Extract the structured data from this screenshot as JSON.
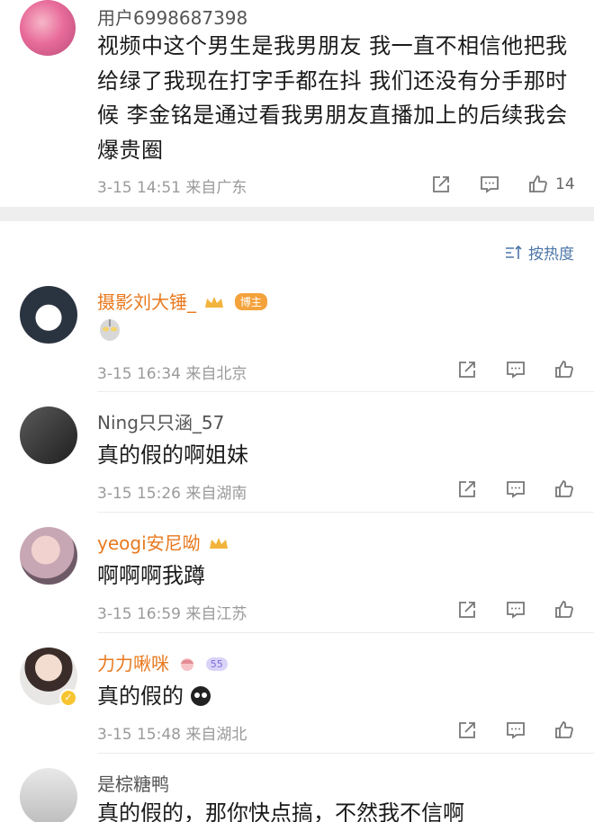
{
  "top_post": {
    "username": "用户6998687398",
    "body": "视频中这个男生是我男朋友 我一直不相信他把我给绿了我现在打字手都在抖 我们还没有分手那时候 李金铭是通过看我男朋友直播加上的后续我会爆贵圈",
    "timestamp": "3-15 14:51",
    "location": "来自广东",
    "like_count": "14",
    "icons": [
      "share-icon",
      "comment-icon",
      "like-icon"
    ]
  },
  "sort": {
    "label": "按热度"
  },
  "comments": [
    {
      "username": "摄影刘大锤_",
      "badge": "博主",
      "text": "",
      "emoji": "ultraman-emoji",
      "timestamp": "3-15 16:34",
      "location": "来自北京"
    },
    {
      "username": "Ning只只涵_57",
      "text": "真的假的啊姐妹",
      "timestamp": "3-15 15:26",
      "location": "来自湖南"
    },
    {
      "username": "yeogi安尼呦",
      "text": "啊啊啊我蹲",
      "timestamp": "3-15 16:59",
      "location": "来自江苏"
    },
    {
      "username": "力力啾咪",
      "text": "真的假的",
      "timestamp": "3-15 15:48",
      "location": "来自湖北"
    },
    {
      "username": "是棕糖鸭",
      "text": "真的假的，那你快点搞，不然我不信啊",
      "timestamp": "",
      "location": ""
    }
  ],
  "colors": {
    "vip_name": "#e8791e",
    "link_blue": "#4c76a8",
    "meta_gray": "#9a9a9a"
  }
}
